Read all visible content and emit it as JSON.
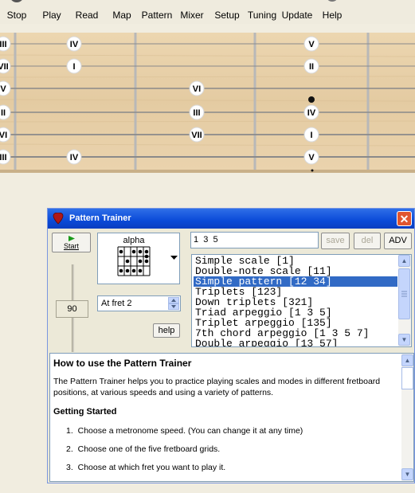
{
  "toolbar": {
    "buttons": [
      {
        "label": "Stop",
        "icon": "stop-icon"
      },
      {
        "label": "Play",
        "icon": "play-icon"
      },
      {
        "label": "Read",
        "icon": "read-icon"
      },
      {
        "label": "Map",
        "icon": "map-icon"
      },
      {
        "label": "Pattern",
        "icon": "pattern-icon"
      },
      {
        "label": "Mixer",
        "icon": "mixer-icon"
      },
      {
        "label": "Setup",
        "icon": "setup-icon"
      },
      {
        "label": "Tuning",
        "icon": "tuning-icon"
      },
      {
        "label": "Update",
        "icon": "update-icon"
      },
      {
        "label": "Help",
        "icon": "help-icon"
      }
    ]
  },
  "fretboard": {
    "strings": [
      {
        "edge": "III",
        "notes": [
          {
            "fret": 1,
            "label": "IV"
          },
          {
            "fret": 3,
            "label": "V"
          }
        ]
      },
      {
        "edge": "VII",
        "notes": [
          {
            "fret": 1,
            "label": "I"
          },
          {
            "fret": 3,
            "label": "II"
          }
        ]
      },
      {
        "edge": "V",
        "notes": [
          {
            "fret": 2,
            "label": "VI"
          }
        ]
      },
      {
        "edge": "II",
        "notes": [
          {
            "fret": 2,
            "label": "III"
          },
          {
            "fret": 3,
            "label": "IV"
          }
        ]
      },
      {
        "edge": "VI",
        "notes": [
          {
            "fret": 2,
            "label": "VII"
          },
          {
            "fret": 3,
            "label": "I"
          }
        ]
      },
      {
        "edge": "III",
        "notes": [
          {
            "fret": 1,
            "label": "IV"
          },
          {
            "fret": 3,
            "label": "V"
          }
        ]
      }
    ]
  },
  "dialog": {
    "title": "Pattern Trainer",
    "close_label": "✕",
    "start_label": "Start",
    "grid_name": "alpha",
    "tempo_value": "90",
    "fret_select": "At fret 2",
    "help_button": "help",
    "pattern_input": "1  3  5",
    "save_label": "save",
    "del_label": "del",
    "adv_label": "ADV",
    "patterns": [
      "Simple scale [1]",
      "Double-note scale [11]",
      "Simple pattern [12 34]",
      "Triplets [123]",
      "Down triplets [321]",
      "Triad arpeggio [1 3 5]",
      "Triplet arpeggio [135]",
      "7th chord arpeggio [1 3 5 7]",
      "Double arpeggio [13 57]"
    ],
    "selected_pattern_index": 2,
    "help": {
      "heading": "How to use the Pattern Trainer",
      "intro": "The Pattern Trainer helps you to practice playing scales and modes in different fretboard positions, at various speeds and using a variety of patterns.",
      "getting_started": "Getting Started",
      "steps": [
        {
          "num": "1.",
          "text": "Choose a metronome speed. (You can change it at any time)"
        },
        {
          "num": "2.",
          "text": "Choose one of the five fretboard grids."
        },
        {
          "num": "3.",
          "text": "Choose at which fret you want to play it."
        }
      ]
    }
  },
  "colors": {
    "titlebar": "#0a4ad8",
    "selection": "#316ac5",
    "wood": "#e8d0a8"
  }
}
